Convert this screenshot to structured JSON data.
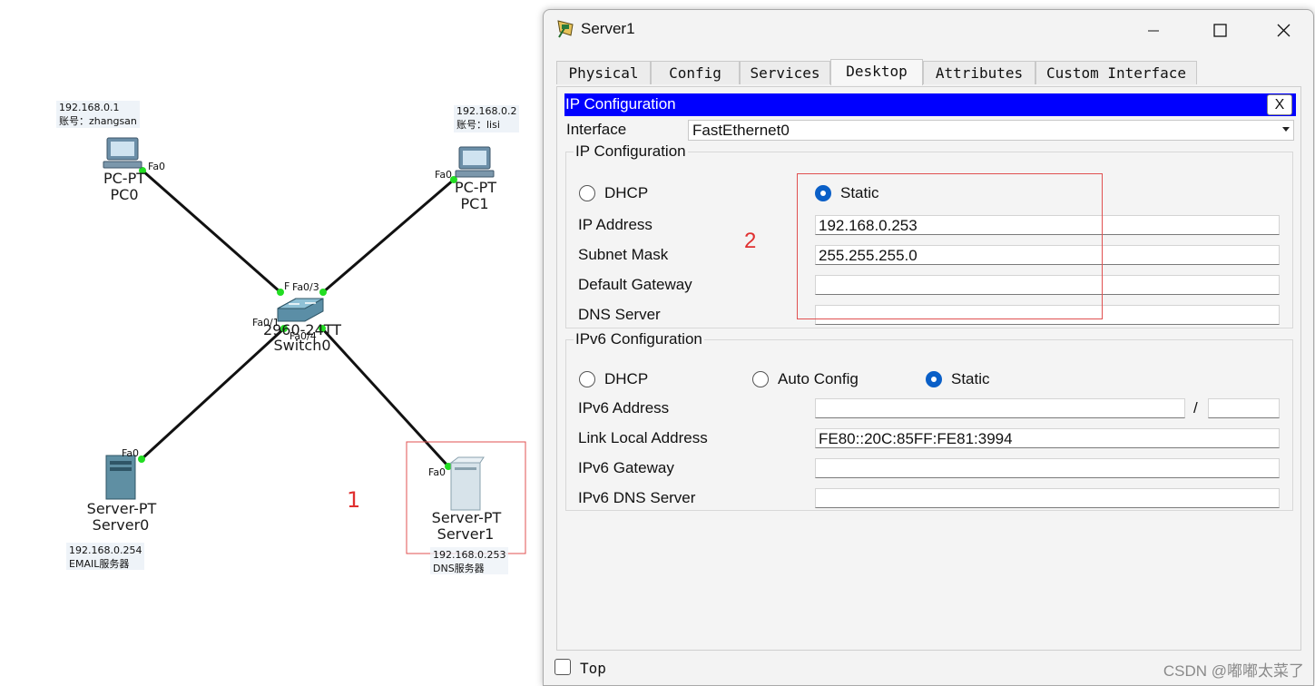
{
  "topology": {
    "devices": [
      {
        "id": "pc0",
        "model": "PC-PT",
        "name": "PC0",
        "note1": "192.168.0.1",
        "note2": "账号：zhangsan",
        "port": "Fa0"
      },
      {
        "id": "pc1",
        "model": "PC-PT",
        "name": "PC1",
        "note1": "192.168.0.2",
        "note2": "账号：lisi",
        "port": "Fa0"
      },
      {
        "id": "switch0",
        "model": "2960-24TT",
        "name": "Switch0"
      },
      {
        "id": "server0",
        "model": "Server-PT",
        "name": "Server0",
        "note1": "192.168.0.254",
        "note2": "EMAIL服务器",
        "port": "Fa0"
      },
      {
        "id": "server1",
        "model": "Server-PT",
        "name": "Server1",
        "note1": "192.168.0.253",
        "note2": "DNS服务器",
        "port": "Fa0"
      }
    ],
    "switch_ports": {
      "p1": "Fa0/1",
      "p2": "F",
      "p3": "Fa0/3",
      "p4": "Fa0/4"
    },
    "marker1": "1",
    "marker2": "2"
  },
  "window": {
    "title": "Server1",
    "tabs": [
      "Physical",
      "Config",
      "Services",
      "Desktop",
      "Attributes",
      "Custom Interface"
    ],
    "active_tab": "Desktop",
    "ipconfig": {
      "header": "IP Configuration",
      "close": "X",
      "interface_label": "Interface",
      "interface_value": "FastEthernet0",
      "ipv4_group": "IP Configuration",
      "dhcp_label": "DHCP",
      "static_label": "Static",
      "ipv4_mode": "Static",
      "ip_label": "IP Address",
      "ip_value": "192.168.0.253",
      "mask_label": "Subnet Mask",
      "mask_value": "255.255.255.0",
      "gw_label": "Default Gateway",
      "gw_value": "",
      "dns_label": "DNS Server",
      "dns_value": "",
      "ipv6_group": "IPv6 Configuration",
      "v6_dhcp_label": "DHCP",
      "v6_auto_label": "Auto Config",
      "v6_static_label": "Static",
      "ipv6_mode": "Static",
      "v6_addr_label": "IPv6 Address",
      "v6_addr_value": "",
      "v6_slash": "/",
      "v6_prefix_value": "",
      "v6_ll_label": "Link Local Address",
      "v6_ll_value": "FE80::20C:85FF:FE81:3994",
      "v6_gw_label": "IPv6 Gateway",
      "v6_gw_value": "",
      "v6_dns_label": "IPv6 DNS Server",
      "v6_dns_value": ""
    },
    "top_checkbox_label": "Top",
    "top_checked": false
  },
  "watermark": "CSDN @嘟嘟太菜了",
  "colors": {
    "ipbar": "#0000ff",
    "link": "#111111",
    "port_dot": "#22dd22",
    "annotation": "#e03030",
    "radio_on": "#0a5fc7"
  }
}
